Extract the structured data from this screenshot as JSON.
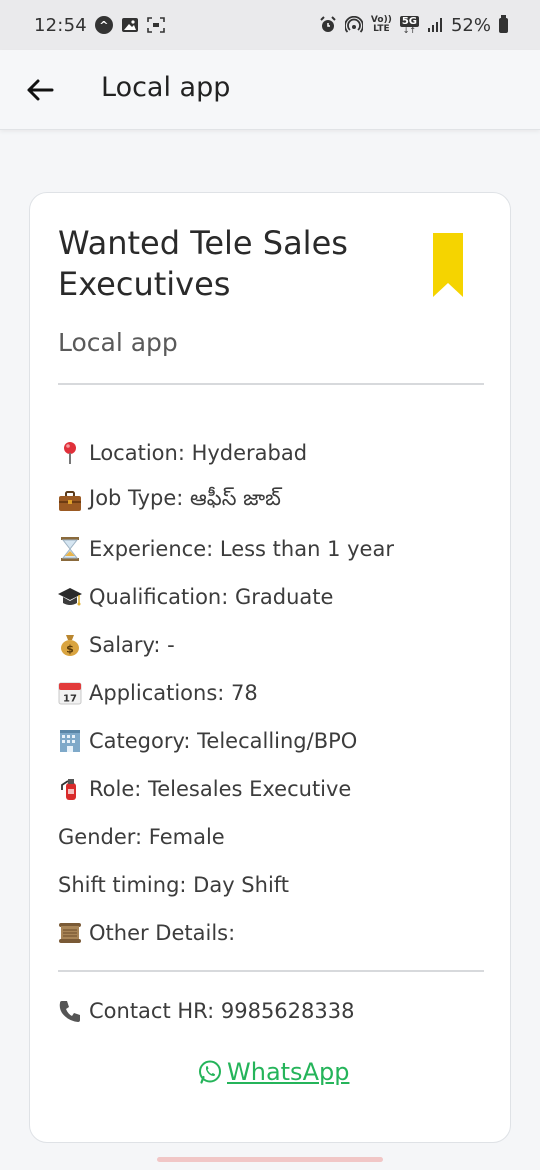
{
  "status_bar": {
    "time": "12:54",
    "battery": "52%",
    "left_icons": [
      "app-circle-icon",
      "image-icon",
      "screenshot-icon"
    ],
    "right_icons": [
      "alarm-icon",
      "hotspot-icon",
      "volte-icon",
      "5g-icon",
      "signal-icon",
      "battery-icon"
    ],
    "volte_top": "Vo))",
    "volte_bottom": "LTE",
    "fiveg": "5G"
  },
  "app_bar": {
    "title": "Local app"
  },
  "job": {
    "title": "Wanted Tele Sales Executives",
    "company": "Local app",
    "bookmark_color": "#f5d400",
    "details": [
      {
        "icon": "location-pin-icon",
        "text": "Location: Hyderabad"
      },
      {
        "icon": "briefcase-icon",
        "text": "Job Type: ఆఫీస్ జాబ్"
      },
      {
        "icon": "hourglass-icon",
        "text": "Experience: Less than 1 year"
      },
      {
        "icon": "graduation-cap-icon",
        "text": "Qualification: Graduate"
      },
      {
        "icon": "money-bag-icon",
        "text": "Salary: -"
      },
      {
        "icon": "calendar-icon",
        "text": "Applications: 78"
      },
      {
        "icon": "office-building-icon",
        "text": "Category: Telecalling/BPO"
      },
      {
        "icon": "fire-extinguisher-icon",
        "text": "Role: Telesales Executive"
      },
      {
        "icon": "",
        "text": "Gender: Female"
      },
      {
        "icon": "",
        "text": "Shift timing: Day Shift"
      },
      {
        "icon": "scroll-icon",
        "text": "Other Details:"
      }
    ],
    "contact": {
      "icon": "phone-icon",
      "text": "Contact HR: 9985628338"
    },
    "whatsapp_label": "WhatsApp",
    "whatsapp_color": "#25b45a"
  }
}
